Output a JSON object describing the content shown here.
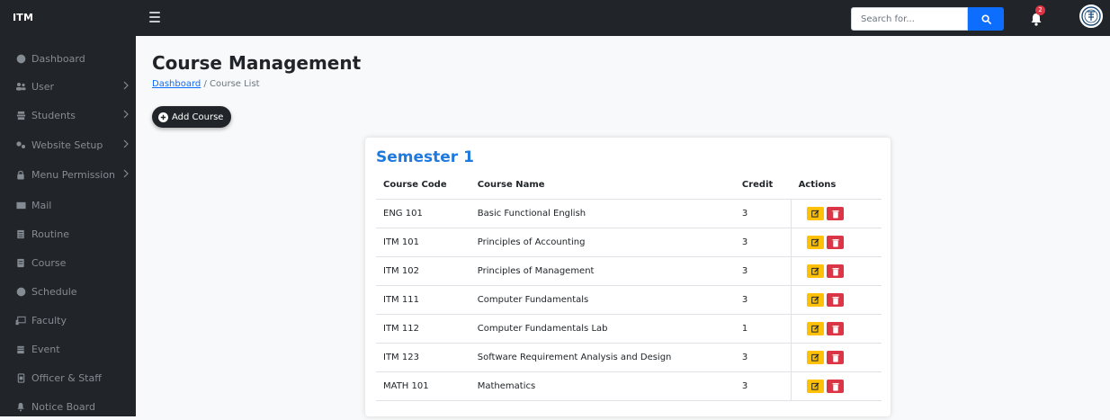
{
  "header": {
    "brand": "ITM",
    "search_placeholder": "Search for...",
    "notification_count": "2"
  },
  "sidebar": {
    "items": [
      {
        "label": "Dashboard",
        "icon": "dashboard-icon",
        "chevron": false
      },
      {
        "label": "User",
        "icon": "users-icon",
        "chevron": true
      },
      {
        "label": "Students",
        "icon": "students-icon",
        "chevron": true
      },
      {
        "label": "Website Setup",
        "icon": "gears-icon",
        "chevron": true
      },
      {
        "label": "Menu Permission",
        "icon": "lock-icon",
        "chevron": true
      },
      {
        "label": "Mail",
        "icon": "mail-icon",
        "chevron": false
      },
      {
        "label": "Routine",
        "icon": "routine-icon",
        "chevron": false
      },
      {
        "label": "Course",
        "icon": "book-icon",
        "chevron": false
      },
      {
        "label": "Schedule",
        "icon": "clock-icon",
        "chevron": false
      },
      {
        "label": "Faculty",
        "icon": "faculty-icon",
        "chevron": false
      },
      {
        "label": "Event",
        "icon": "calendar-icon",
        "chevron": false
      },
      {
        "label": "Officer & Staff",
        "icon": "staff-icon",
        "chevron": false
      },
      {
        "label": "Notice Board",
        "icon": "bell-icon",
        "chevron": false
      }
    ]
  },
  "page": {
    "title": "Course Management",
    "breadcrumb_link": "Dashboard",
    "breadcrumb_sep": "/",
    "breadcrumb_current": "Course List",
    "add_button": "Add Course"
  },
  "card": {
    "semester": "Semester 1",
    "columns": [
      "Course Code",
      "Course Name",
      "Credit",
      "Actions"
    ],
    "rows": [
      {
        "code": "ENG 101",
        "name": "Basic Functional English",
        "credit": "3"
      },
      {
        "code": "ITM 101",
        "name": "Principles of Accounting",
        "credit": "3"
      },
      {
        "code": "ITM 102",
        "name": "Principles of Management",
        "credit": "3"
      },
      {
        "code": "ITM 111",
        "name": "Computer Fundamentals",
        "credit": "3"
      },
      {
        "code": "ITM 112",
        "name": "Computer Fundamentals Lab",
        "credit": "1"
      },
      {
        "code": "ITM 123",
        "name": "Software Requirement Analysis and Design",
        "credit": "3"
      },
      {
        "code": "MATH 101",
        "name": "Mathematics",
        "credit": "3"
      }
    ]
  },
  "colors": {
    "dark": "#212529",
    "primary": "#0d6efd",
    "semester_title": "#1f7ae0",
    "edit": "#ffc107",
    "delete": "#dc3545"
  }
}
